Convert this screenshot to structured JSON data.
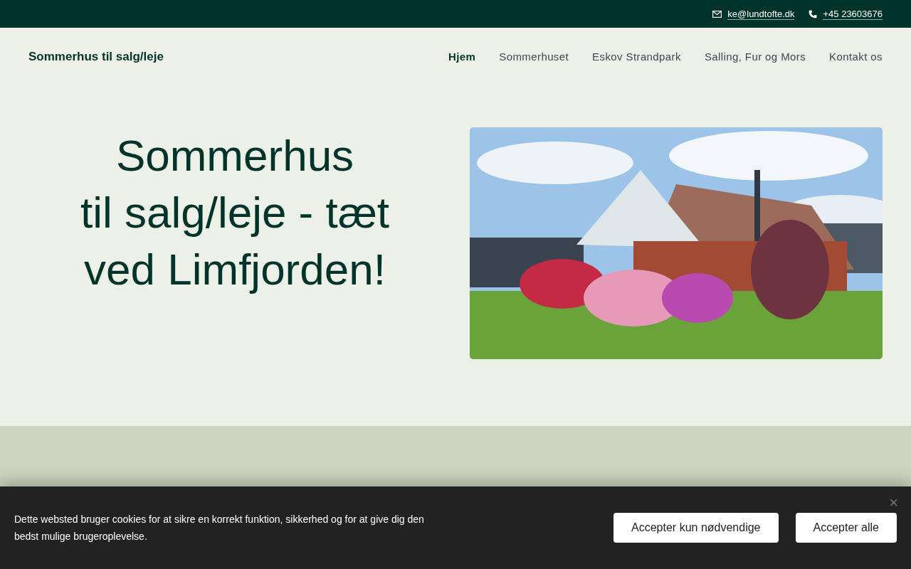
{
  "top_bar": {
    "email": "ke@lundtofte.dk",
    "phone": "+45 23603676"
  },
  "header": {
    "logo": "Sommerhus til salg/leje",
    "nav": [
      {
        "label": "Hjem",
        "selected": true
      },
      {
        "label": "Sommerhuset",
        "selected": false
      },
      {
        "label": "Eskov Strandpark",
        "selected": false
      },
      {
        "label": "Salling, Fur og Mors",
        "selected": false
      },
      {
        "label": "Kontakt os",
        "selected": false
      }
    ]
  },
  "hero": {
    "title_lines": [
      "Sommerhus",
      "til salg/leje - tæt",
      "ved Limfjorden!"
    ]
  },
  "cookie_banner": {
    "text": "Dette websted bruger cookies for at sikre en korrekt funktion, sikkerhed og for at give dig den bedst mulige brugeroplevelse.",
    "buttons": [
      "Accepter kun nødvendige",
      "Accepter alle"
    ],
    "close": "×"
  }
}
